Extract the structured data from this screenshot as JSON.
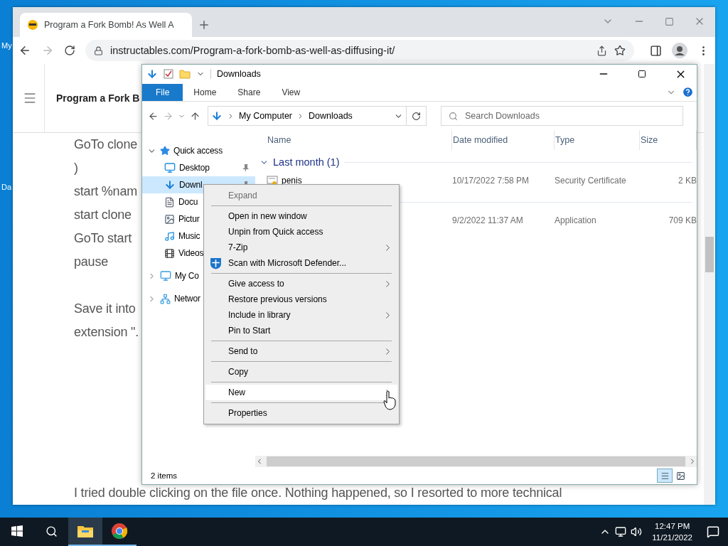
{
  "desktop": {
    "icons": [
      {
        "label": "My"
      },
      {
        "label": "Da"
      }
    ]
  },
  "browser": {
    "tab": {
      "title": "Program a Fork Bomb! As Well A"
    },
    "address": "instructables.com/Program-a-fork-bomb-as-well-as-diffusing-it/",
    "header_title": "Program a Fork B",
    "blocks": [
      [
        "GoTo clone",
        ")",
        "start %nam",
        "start clone",
        "GoTo start",
        "pause"
      ],
      [
        "Save it into",
        "extension \"."
      ]
    ],
    "last_line": "I tried double clicking on the file once. Nothing happened, so I resorted to more technical"
  },
  "explorer": {
    "title": "Downloads",
    "ribbon_tabs": [
      {
        "label": "File",
        "kind": "file"
      },
      {
        "label": "Home",
        "kind": "tab"
      },
      {
        "label": "Share",
        "kind": "tab"
      },
      {
        "label": "View",
        "kind": "tab"
      }
    ],
    "breadcrumb": [
      "My Computer",
      "Downloads"
    ],
    "search": {
      "placeholder": "Search Downloads"
    },
    "nav": [
      {
        "label": "Quick access",
        "kind": "star",
        "expanded": true,
        "children": [
          {
            "label": "Desktop",
            "kind": "desktop",
            "pinned": true,
            "selected": false
          },
          {
            "label": "Downl",
            "kind": "download",
            "pinned": true,
            "selected": true
          },
          {
            "label": "Docu",
            "kind": "document",
            "selected": false
          },
          {
            "label": "Pictur",
            "kind": "picture",
            "selected": false
          },
          {
            "label": "Music",
            "kind": "music",
            "selected": false
          },
          {
            "label": "Videos",
            "kind": "video",
            "selected": false
          }
        ]
      },
      {
        "label": "My Co",
        "kind": "computer",
        "expanded": false
      },
      {
        "label": "Networ",
        "kind": "network",
        "expanded": false
      }
    ],
    "columns": [
      "Name",
      "Date modified",
      "Type",
      "Size"
    ],
    "groups": [
      {
        "label": "Last month (1)",
        "files": [
          {
            "name": "penis",
            "kind": "certificate",
            "date": "10/17/2022 7:58 PM",
            "type": "Security Certificate",
            "size": "2 KB"
          }
        ]
      },
      {
        "files": [
          {
            "kind": "hidden",
            "date": "9/2/2022 11:37 AM",
            "type": "Application",
            "size": "709 KB"
          }
        ]
      }
    ],
    "status": "2 items"
  },
  "context_menu": [
    {
      "kind": "item",
      "label": "Expand",
      "disabled": true,
      "submenu": false,
      "icon": false,
      "selected": false
    },
    {
      "kind": "separator"
    },
    {
      "kind": "item",
      "label": "Open in new window",
      "disabled": false,
      "submenu": false,
      "icon": false,
      "selected": false
    },
    {
      "kind": "item",
      "label": "Unpin from Quick access",
      "disabled": false,
      "submenu": false,
      "icon": false,
      "selected": false
    },
    {
      "kind": "item",
      "label": "7-Zip",
      "disabled": false,
      "submenu": true,
      "icon": false,
      "selected": false
    },
    {
      "kind": "item",
      "label": "Scan with Microsoft Defender...",
      "disabled": false,
      "submenu": false,
      "icon": true,
      "selected": false
    },
    {
      "kind": "separator"
    },
    {
      "kind": "item",
      "label": "Give access to",
      "disabled": false,
      "submenu": true,
      "icon": false,
      "selected": false
    },
    {
      "kind": "item",
      "label": "Restore previous versions",
      "disabled": false,
      "submenu": false,
      "icon": false,
      "selected": false
    },
    {
      "kind": "item",
      "label": "Include in library",
      "disabled": false,
      "submenu": true,
      "icon": false,
      "selected": false
    },
    {
      "kind": "item",
      "label": "Pin to Start",
      "disabled": false,
      "submenu": false,
      "icon": false,
      "selected": false
    },
    {
      "kind": "separator"
    },
    {
      "kind": "item",
      "label": "Send to",
      "disabled": false,
      "submenu": true,
      "icon": false,
      "selected": false
    },
    {
      "kind": "separator"
    },
    {
      "kind": "item",
      "label": "Copy",
      "disabled": false,
      "submenu": false,
      "icon": false,
      "selected": false
    },
    {
      "kind": "separator"
    },
    {
      "kind": "item",
      "label": "New",
      "disabled": false,
      "submenu": true,
      "icon": false,
      "selected": true
    },
    {
      "kind": "separator"
    },
    {
      "kind": "item",
      "label": "Properties",
      "disabled": false,
      "submenu": false,
      "icon": false,
      "selected": false
    }
  ],
  "taskbar": {
    "apps": [
      {
        "kind": "explorer",
        "active": true,
        "running": true
      },
      {
        "kind": "chrome",
        "active": false,
        "running": true
      }
    ],
    "time": "12:47 PM",
    "date": "11/21/2022"
  }
}
